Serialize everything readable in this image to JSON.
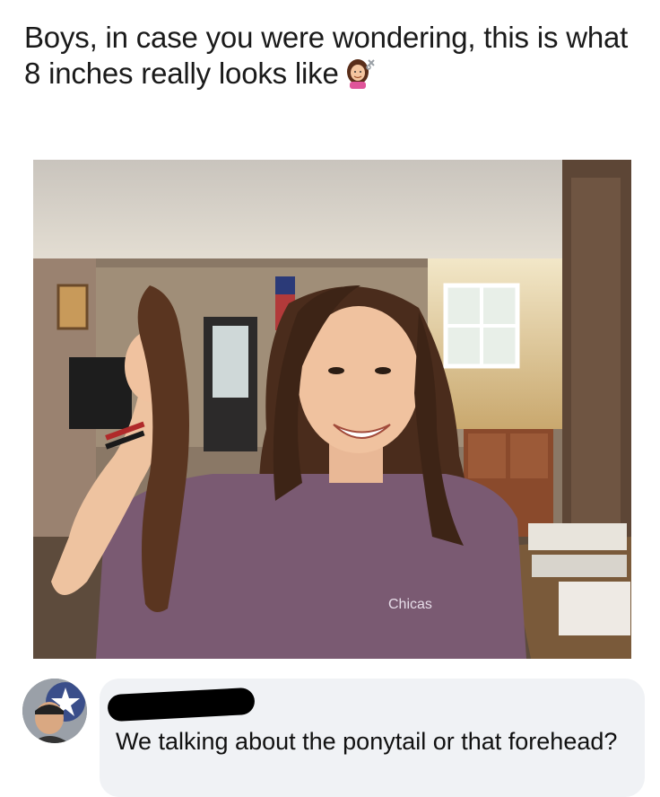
{
  "post": {
    "caption": "Boys, in case you were wondering, this is what 8 inches really looks like",
    "emoji": "woman-getting-haircut-icon"
  },
  "photo": {
    "shirt_text": "Chicas"
  },
  "comment": {
    "text": "We talking about the ponytail or that forehead?"
  }
}
